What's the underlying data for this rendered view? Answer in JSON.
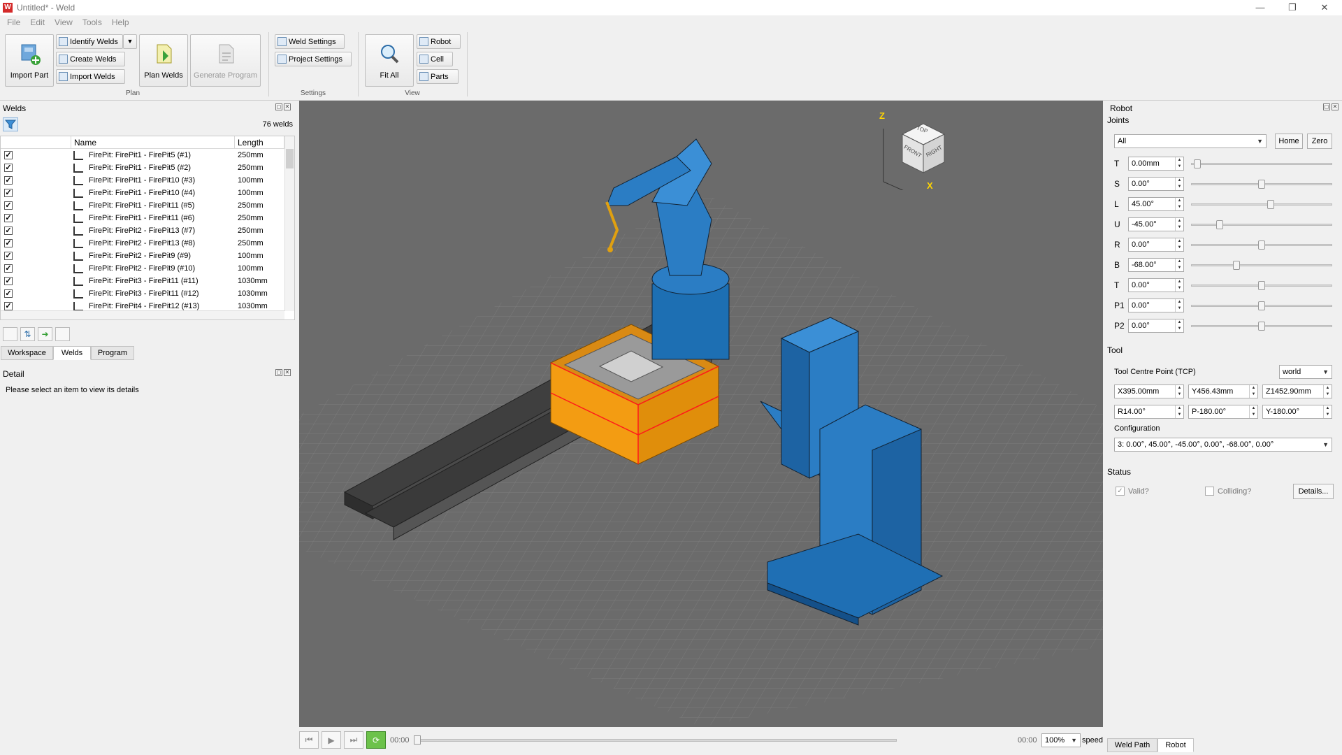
{
  "window": {
    "title": "Untitled* - Weld",
    "minimize": "—",
    "maximize": "❐",
    "close": "✕"
  },
  "menu": [
    "File",
    "Edit",
    "View",
    "Tools",
    "Help"
  ],
  "ribbon": {
    "import_part": "Import Part",
    "identify_welds": "Identify Welds",
    "create_welds": "Create Welds",
    "import_welds": "Import Welds",
    "plan_welds": "Plan Welds",
    "generate_program": "Generate Program",
    "plan_group": "Plan",
    "weld_settings": "Weld Settings",
    "project_settings": "Project Settings",
    "settings_group": "Settings",
    "fit_all": "Fit All",
    "robot": "Robot",
    "cell": "Cell",
    "parts": "Parts",
    "view_group": "View"
  },
  "welds_panel": {
    "title": "Welds",
    "count": "76 welds",
    "col_name": "Name",
    "col_length": "Length",
    "rows": [
      {
        "name": "FirePit: FirePit1 - FirePit5 (#1)",
        "length": "250mm"
      },
      {
        "name": "FirePit: FirePit1 - FirePit5 (#2)",
        "length": "250mm"
      },
      {
        "name": "FirePit: FirePit1 - FirePit10 (#3)",
        "length": "100mm"
      },
      {
        "name": "FirePit: FirePit1 - FirePit10 (#4)",
        "length": "100mm"
      },
      {
        "name": "FirePit: FirePit1 - FirePit11 (#5)",
        "length": "250mm"
      },
      {
        "name": "FirePit: FirePit1 - FirePit11 (#6)",
        "length": "250mm"
      },
      {
        "name": "FirePit: FirePit2 - FirePit13 (#7)",
        "length": "250mm"
      },
      {
        "name": "FirePit: FirePit2 - FirePit13 (#8)",
        "length": "250mm"
      },
      {
        "name": "FirePit: FirePit2 - FirePit9 (#9)",
        "length": "100mm"
      },
      {
        "name": "FirePit: FirePit2 - FirePit9 (#10)",
        "length": "100mm"
      },
      {
        "name": "FirePit: FirePit3 - FirePit11 (#11)",
        "length": "1030mm"
      },
      {
        "name": "FirePit: FirePit3 - FirePit11 (#12)",
        "length": "1030mm"
      },
      {
        "name": "FirePit: FirePit4 - FirePit12 (#13)",
        "length": "1030mm"
      }
    ],
    "check_mark": "✓",
    "tabs": [
      "Workspace",
      "Welds",
      "Program"
    ]
  },
  "detail_panel": {
    "title": "Detail",
    "message": "Please select an item to view its details"
  },
  "viewcube": {
    "top": "TOP",
    "front": "FRONT",
    "right": "RIGHT",
    "z": "Z",
    "x": "X"
  },
  "playback": {
    "time_start": "00:00",
    "time_end": "00:00",
    "zoom": "100%",
    "speed": "speed"
  },
  "bottom_tabs": [
    "Weld Path",
    "Robot"
  ],
  "robot_panel": {
    "title": "Robot",
    "joints_title": "Joints",
    "joint_select": "All",
    "home": "Home",
    "zero": "Zero",
    "joints": [
      {
        "label": "T",
        "value": "0.00mm",
        "pos": 0.02
      },
      {
        "label": "S",
        "value": "0.00°",
        "pos": 0.5
      },
      {
        "label": "L",
        "value": "45.00°",
        "pos": 0.57
      },
      {
        "label": "U",
        "value": "-45.00°",
        "pos": 0.19
      },
      {
        "label": "R",
        "value": "0.00°",
        "pos": 0.5
      },
      {
        "label": "B",
        "value": "-68.00°",
        "pos": 0.31
      },
      {
        "label": "T",
        "value": "0.00°",
        "pos": 0.5
      },
      {
        "label": "P1",
        "value": "0.00°",
        "pos": 0.5
      },
      {
        "label": "P2",
        "value": "0.00°",
        "pos": 0.5
      }
    ],
    "tool_title": "Tool",
    "tcp_label": "Tool Centre Point (TCP)",
    "tcp_frame": "world",
    "tcp": [
      "X395.00mm",
      "Y456.43mm",
      "Z1452.90mm",
      "R14.00°",
      "P-180.00°",
      "Y-180.00°"
    ],
    "config_label": "Configuration",
    "config_value": "3: 0.00°, 45.00°, -45.00°, 0.00°, -68.00°, 0.00°",
    "status_title": "Status",
    "valid": "Valid?",
    "colliding": "Colliding?",
    "details": "Details..."
  }
}
